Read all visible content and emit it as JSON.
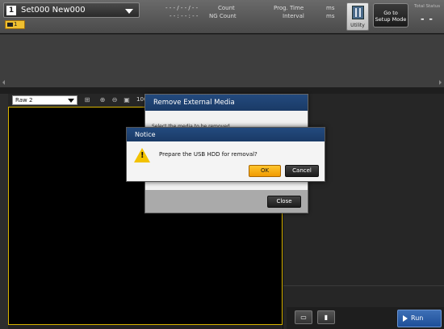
{
  "topbar": {
    "set_number": "1",
    "set_name": "Set000  New000",
    "camera_tab": "1",
    "meas": [
      {
        "value": "- - - / - - / - -",
        "label": "Count"
      },
      {
        "value": "- - : - - : - -",
        "label": "NG Count"
      },
      {
        "value": "Prog. Time",
        "label": "Interval"
      },
      {
        "value": "ms",
        "label": "ms"
      }
    ],
    "utility_label": "Utility",
    "setup_label_1": "Go to",
    "setup_label_2": "Setup Mode",
    "total_status_label": "Total Status",
    "total_status_value": "- -"
  },
  "image_panel": {
    "image_select": "Raw 2",
    "zoom": "100"
  },
  "remove_dialog": {
    "title": "Remove External Media",
    "body": "Select the media to be removed.",
    "close_label": "Close"
  },
  "notice_dialog": {
    "title": "Notice",
    "message": "Prepare the USB HDD for removal?",
    "ok_label": "OK",
    "cancel_label": "Cancel"
  },
  "bottom": {
    "run_label": "Run"
  },
  "colors": {
    "accent": "#f2c200",
    "dialog_header": "#1a3a66",
    "run_button": "#1e4f99"
  }
}
